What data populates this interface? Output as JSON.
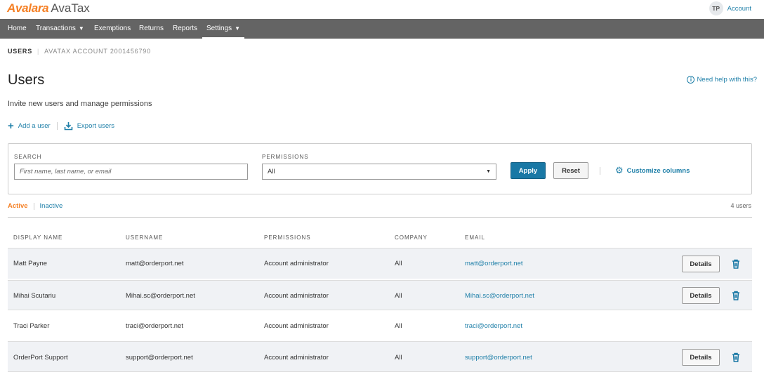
{
  "app": {
    "brand": "Avalara",
    "product": "AvaTax"
  },
  "account": {
    "initials": "TP",
    "label": "Account"
  },
  "nav": [
    {
      "label": "Home",
      "has_caret": false
    },
    {
      "label": "Transactions",
      "has_caret": true,
      "caret": "▼"
    },
    {
      "label": "Exemptions",
      "has_caret": false
    },
    {
      "label": "Returns",
      "has_caret": false
    },
    {
      "label": "Reports",
      "has_caret": false
    },
    {
      "label": "Settings",
      "has_caret": true,
      "caret": "▼",
      "active": true
    }
  ],
  "breadcrumb": {
    "current": "USERS",
    "sep": "|",
    "account": "AVATAX ACCOUNT 2001456790"
  },
  "page": {
    "title": "Users",
    "subtitle": "Invite new users and manage permissions",
    "help_link": "Need help with this?"
  },
  "actions": {
    "add_user": "Add a user",
    "export_users": "Export users"
  },
  "filters": {
    "search_label": "SEARCH",
    "search_placeholder": "First name, last name, or email",
    "search_value": "",
    "permissions_label": "PERMISSIONS",
    "permissions_value": "All",
    "apply_label": "Apply",
    "reset_label": "Reset",
    "customize_label": "Customize columns"
  },
  "tabs": {
    "active": "Active",
    "inactive": "Inactive",
    "count": "4 users"
  },
  "table": {
    "headers": [
      "DISPLAY NAME",
      "USERNAME",
      "PERMISSIONS",
      "COMPANY",
      "EMAIL"
    ],
    "details_label": "Details",
    "rows": [
      {
        "display_name": "Matt Payne",
        "username": "matt@orderport.net",
        "permissions": "Account administrator",
        "company": "All",
        "email": "matt@orderport.net",
        "has_actions": true
      },
      {
        "display_name": "Mihai Scutariu",
        "username": "Mihai.sc@orderport.net",
        "permissions": "Account administrator",
        "company": "All",
        "email": "Mihai.sc@orderport.net",
        "has_actions": true
      },
      {
        "display_name": "Traci Parker",
        "username": "traci@orderport.net",
        "permissions": "Account administrator",
        "company": "All",
        "email": "traci@orderport.net",
        "has_actions": false
      },
      {
        "display_name": "OrderPort Support",
        "username": "support@orderport.net",
        "permissions": "Account administrator",
        "company": "All",
        "email": "support@orderport.net",
        "has_actions": true
      }
    ]
  },
  "colors": {
    "brand_orange": "#f58025",
    "link_blue": "#1e7fa8",
    "nav_bg": "#646464",
    "apply_blue": "#1978a5",
    "row_shade": "#f0f2f5"
  },
  "icons": {
    "help": "info-icon",
    "add": "plus-icon",
    "export": "download-icon",
    "customize": "gear-icon",
    "delete": "trash-icon",
    "dropdown": "chevron-down-icon"
  }
}
